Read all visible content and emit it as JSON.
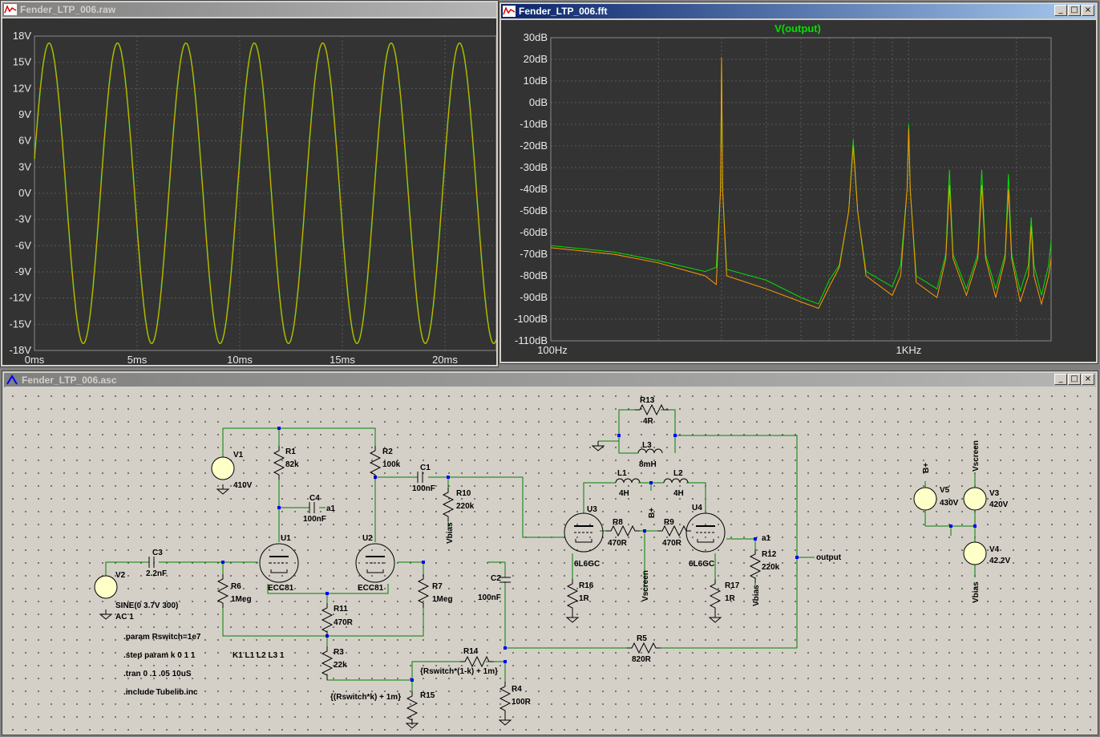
{
  "raw_window": {
    "title": "Fender_LTP_006.raw",
    "icon": "waveform-icon"
  },
  "fft_window": {
    "title": "Fender_LTP_006.fft",
    "icon": "waveform-icon",
    "trace_label": "V(output)"
  },
  "sch_window": {
    "title": "Fender_LTP_006.asc",
    "icon": "schematic-icon"
  },
  "window_controls": {
    "minimize": "_",
    "maximize": "□",
    "close": "×"
  },
  "colors": {
    "trace_green": "#00e000",
    "trace_orange": "#ff9900",
    "plot_bg": "#333333",
    "wire": "#008000",
    "junction": "#0000ff"
  },
  "chart_data": [
    {
      "type": "line",
      "title": "",
      "x_ticks": [
        "0ms",
        "5ms",
        "10ms",
        "15ms",
        "20ms"
      ],
      "y_ticks": [
        "18V",
        "15V",
        "12V",
        "9V",
        "6V",
        "3V",
        "0V",
        "-3V",
        "-6V",
        "-9V",
        "-12V",
        "-15V",
        "-18V"
      ],
      "xlim": [
        0,
        22.5
      ],
      "ylim": [
        -18,
        18
      ],
      "series": [
        {
          "color": "#00e000",
          "amplitude": 17.2,
          "frequency_hz": 300
        },
        {
          "color": "#ff9900",
          "amplitude": 17.2,
          "frequency_hz": 300
        }
      ]
    },
    {
      "type": "line",
      "title": "V(output)",
      "x_ticks": [
        "100Hz",
        "1KHz"
      ],
      "y_ticks": [
        "30dB",
        "20dB",
        "10dB",
        "0dB",
        "-10dB",
        "-20dB",
        "-30dB",
        "-40dB",
        "-50dB",
        "-60dB",
        "-70dB",
        "-80dB",
        "-90dB",
        "-100dB",
        "-110dB"
      ],
      "xlim": [
        100,
        2500
      ],
      "ylim": [
        -110,
        30
      ],
      "x_scale": "log",
      "series": [
        {
          "color": "#00e000",
          "points": [
            [
              100,
              -66
            ],
            [
              150,
              -69
            ],
            [
              200,
              -73
            ],
            [
              270,
              -78
            ],
            [
              290,
              -76
            ],
            [
              298,
              -40
            ],
            [
              300,
              19
            ],
            [
              302,
              -40
            ],
            [
              310,
              -77
            ],
            [
              400,
              -82
            ],
            [
              500,
              -90
            ],
            [
              560,
              -93
            ],
            [
              600,
              -82
            ],
            [
              640,
              -75
            ],
            [
              680,
              -50
            ],
            [
              700,
              -17
            ],
            [
              720,
              -50
            ],
            [
              760,
              -78
            ],
            [
              900,
              -85
            ],
            [
              950,
              -75
            ],
            [
              990,
              -40
            ],
            [
              1000,
              -10
            ],
            [
              1010,
              -40
            ],
            [
              1050,
              -80
            ],
            [
              1200,
              -86
            ],
            [
              1270,
              -70
            ],
            [
              1300,
              -31
            ],
            [
              1330,
              -70
            ],
            [
              1450,
              -86
            ],
            [
              1560,
              -70
            ],
            [
              1600,
              -31
            ],
            [
              1640,
              -70
            ],
            [
              1750,
              -86
            ],
            [
              1860,
              -70
            ],
            [
              1900,
              -33
            ],
            [
              1940,
              -70
            ],
            [
              2050,
              -87
            ],
            [
              2160,
              -75
            ],
            [
              2200,
              -53
            ],
            [
              2240,
              -75
            ],
            [
              2350,
              -89
            ],
            [
              2460,
              -75
            ],
            [
              2500,
              -64
            ]
          ]
        },
        {
          "color": "#ff9900",
          "points": [
            [
              100,
              -67
            ],
            [
              150,
              -70
            ],
            [
              200,
              -74
            ],
            [
              270,
              -80
            ],
            [
              290,
              -84
            ],
            [
              298,
              -40
            ],
            [
              300,
              21
            ],
            [
              302,
              -40
            ],
            [
              310,
              -80
            ],
            [
              400,
              -86
            ],
            [
              500,
              -92
            ],
            [
              560,
              -95
            ],
            [
              600,
              -85
            ],
            [
              640,
              -76
            ],
            [
              680,
              -50
            ],
            [
              700,
              -20
            ],
            [
              720,
              -50
            ],
            [
              760,
              -80
            ],
            [
              900,
              -89
            ],
            [
              950,
              -80
            ],
            [
              990,
              -40
            ],
            [
              1000,
              -12
            ],
            [
              1010,
              -40
            ],
            [
              1050,
              -83
            ],
            [
              1200,
              -90
            ],
            [
              1270,
              -72
            ],
            [
              1300,
              -38
            ],
            [
              1330,
              -72
            ],
            [
              1450,
              -89
            ],
            [
              1560,
              -72
            ],
            [
              1600,
              -38
            ],
            [
              1640,
              -72
            ],
            [
              1750,
              -90
            ],
            [
              1860,
              -72
            ],
            [
              1900,
              -40
            ],
            [
              1940,
              -72
            ],
            [
              2050,
              -92
            ],
            [
              2160,
              -80
            ],
            [
              2200,
              -57
            ],
            [
              2240,
              -80
            ],
            [
              2350,
              -93
            ],
            [
              2460,
              -80
            ],
            [
              2500,
              -72
            ]
          ]
        }
      ]
    }
  ],
  "schematic": {
    "components": {
      "V1": {
        "name": "V1",
        "value": "410V"
      },
      "V2": {
        "name": "V2",
        "value": "SINE(0 3.7V 300)",
        "ac": "AC 1"
      },
      "V3": {
        "name": "V3",
        "value": "420V"
      },
      "V4": {
        "name": "V4",
        "value": "42.2V"
      },
      "V5": {
        "name": "V5",
        "value": "430V"
      },
      "R1": {
        "name": "R1",
        "value": "82k"
      },
      "R2": {
        "name": "R2",
        "value": "100k"
      },
      "R3": {
        "name": "R3",
        "value": "22k"
      },
      "R4": {
        "name": "R4",
        "value": "100R"
      },
      "R5": {
        "name": "R5",
        "value": "820R"
      },
      "R6": {
        "name": "R6",
        "value": "1Meg"
      },
      "R7": {
        "name": "R7",
        "value": "1Meg"
      },
      "R8": {
        "name": "R8",
        "value": "470R"
      },
      "R9": {
        "name": "R9",
        "value": "470R"
      },
      "R10": {
        "name": "R10",
        "value": "220k"
      },
      "R11": {
        "name": "R11",
        "value": "470R"
      },
      "R12": {
        "name": "R12",
        "value": "220k"
      },
      "R13": {
        "name": "R13",
        "value": "4R"
      },
      "R14": {
        "name": "R14",
        "value": "{Rswitch*(1-k) + 1m}"
      },
      "R15": {
        "name": "R15",
        "value": "{(Rswitch*k) + 1m}"
      },
      "R16": {
        "name": "R16",
        "value": "1R"
      },
      "R17": {
        "name": "R17",
        "value": "1R"
      },
      "C1": {
        "name": "C1",
        "value": "100nF"
      },
      "C2": {
        "name": "C2",
        "value": "100nF"
      },
      "C3": {
        "name": "C3",
        "value": "2.2nF"
      },
      "C4": {
        "name": "C4",
        "value": "100nF"
      },
      "L1": {
        "name": "L1",
        "value": "4H"
      },
      "L2": {
        "name": "L2",
        "value": "4H"
      },
      "L3": {
        "name": "L3",
        "value": "8mH"
      },
      "U1": {
        "name": "U1",
        "value": "ECC81"
      },
      "U2": {
        "name": "U2",
        "value": "ECC81"
      },
      "U3": {
        "name": "U3",
        "value": "6L6GC"
      },
      "U4": {
        "name": "U4",
        "value": "6L6GC"
      }
    },
    "nets": {
      "a1": "a1",
      "output": "output",
      "bplus": "B+",
      "vbias": "Vbias",
      "vscreen": "Vscreen"
    },
    "directives": [
      ".param Rswitch=1e7",
      ".step param k 0 1 1",
      ".tran 0 .1 .05 10uS",
      ".include Tubelib.inc"
    ],
    "coupling": "K1 L1 L2 L3 1"
  }
}
